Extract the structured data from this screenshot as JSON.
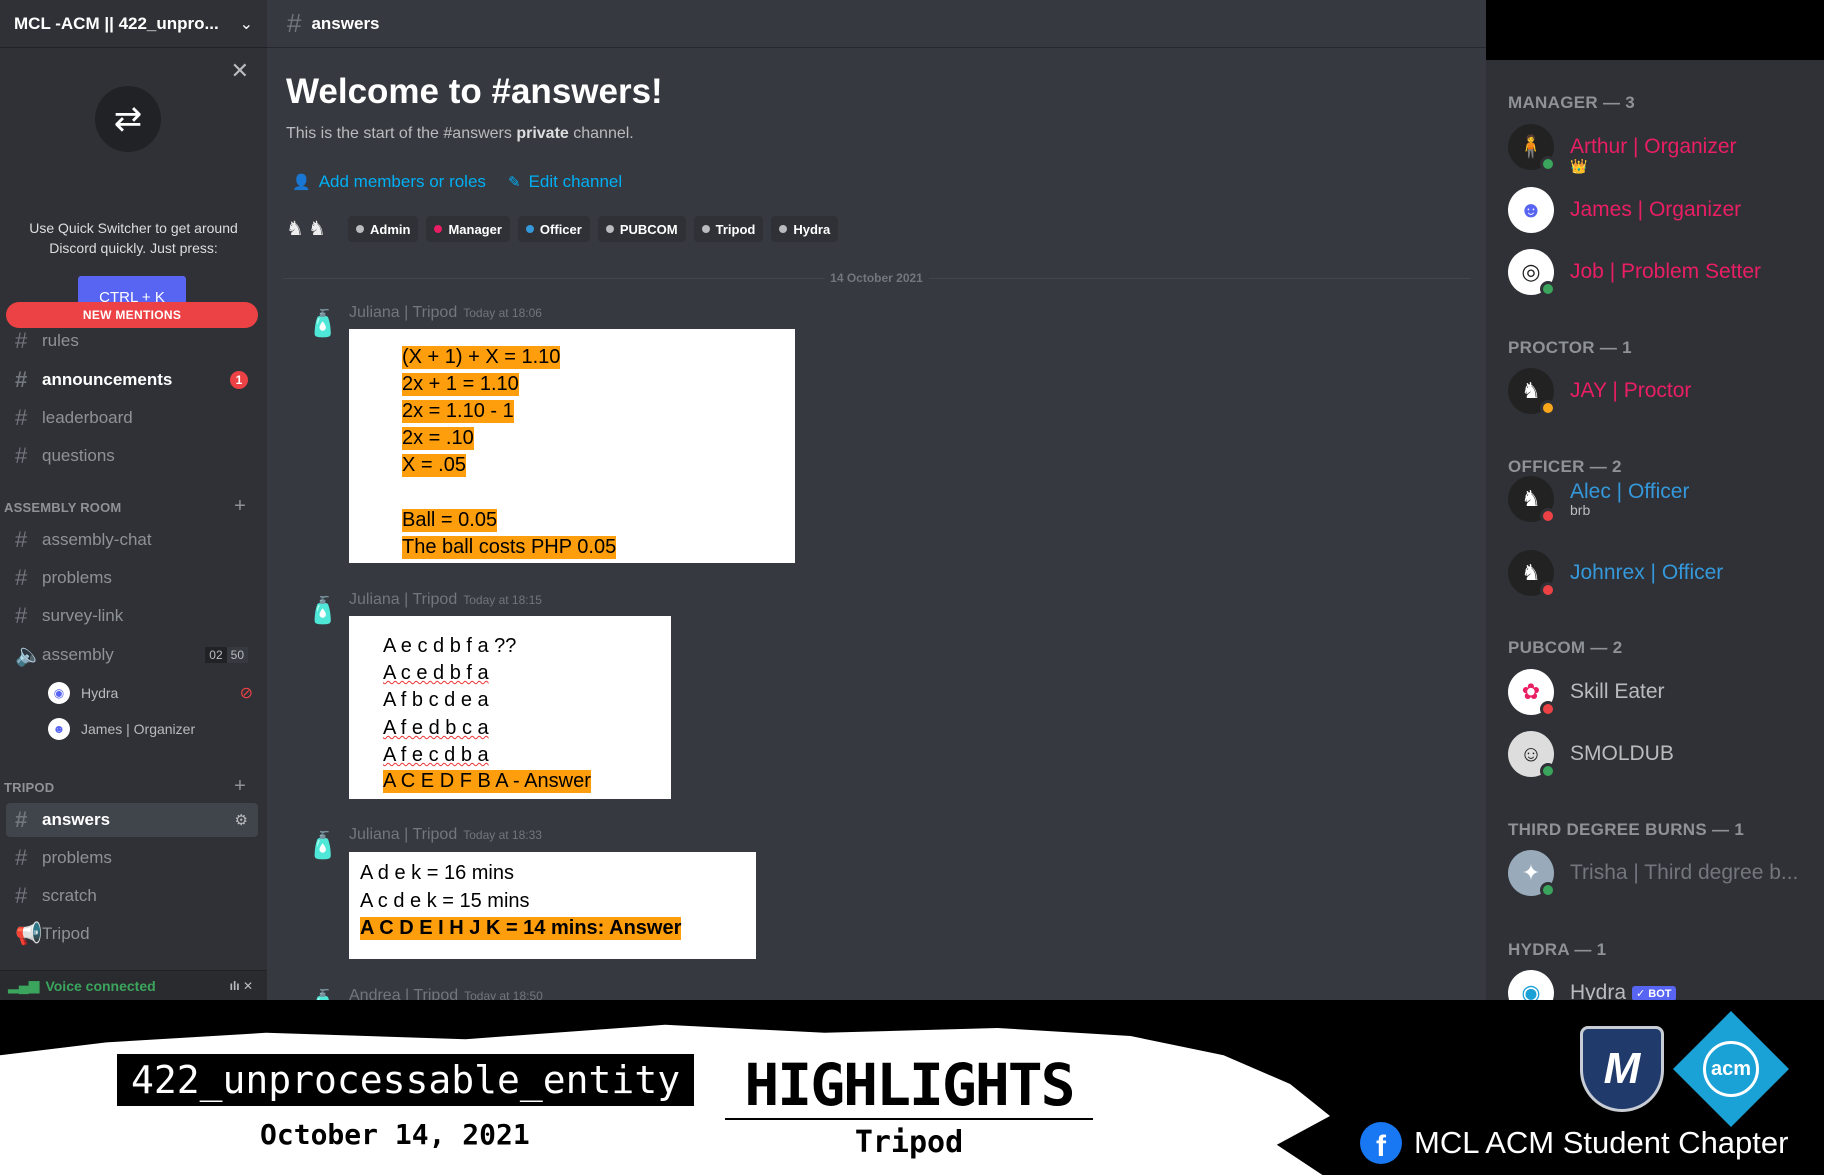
{
  "server": {
    "name": "MCL -ACM || 422_unpro..."
  },
  "quick_switcher": {
    "text_line1": "Use Quick Switcher to get around",
    "text_line2": "Discord quickly. Just press:",
    "shortcut": "CTRL + K"
  },
  "new_mentions": "NEW MENTIONS",
  "channels_top": [
    {
      "name": "rules",
      "bold": false
    },
    {
      "name": "announcements",
      "bold": true,
      "badge": "1"
    },
    {
      "name": "leaderboard",
      "bold": false
    },
    {
      "name": "questions",
      "bold": false
    }
  ],
  "assembly_room": {
    "label": "ASSEMBLY ROOM",
    "channels": [
      "assembly-chat",
      "problems",
      "survey-link"
    ],
    "voice": {
      "name": "assembly",
      "count_a": "02",
      "count_b": "50"
    },
    "voice_users": [
      "Hydra",
      "James | Organizer"
    ]
  },
  "tripod": {
    "label": "TRIPOD",
    "channels": [
      "answers",
      "problems",
      "scratch"
    ],
    "stage": "Tripod"
  },
  "voice_status": "Voice connected",
  "channel": {
    "name": "answers",
    "welcome_title": "Welcome to #answers!",
    "welcome_sub_pre": "This is the start of the #answers ",
    "welcome_sub_bold": "private",
    "welcome_sub_post": " channel.",
    "add_members": "Add members or roles",
    "edit_channel": "Edit channel",
    "roles": [
      {
        "name": "Admin",
        "color": "#b9bbbe"
      },
      {
        "name": "Manager",
        "color": "#e91e63"
      },
      {
        "name": "Officer",
        "color": "#3498db"
      },
      {
        "name": "PUBCOM",
        "color": "#b9bbbe"
      },
      {
        "name": "Tripod",
        "color": "#b9bbbe"
      },
      {
        "name": "Hydra",
        "color": "#b9bbbe"
      }
    ],
    "date_divider": "14 October 2021"
  },
  "messages": [
    {
      "author": "Juliana | Tripod",
      "time": "Today at 18:06",
      "lines": [
        "(X + 1) + X = 1.10",
        "2x + 1 = 1.10",
        "2x = 1.10 - 1",
        "2x = .10",
        "X = .05",
        "",
        "Ball = 0.05",
        "The ball costs PHP 0.05"
      ]
    },
    {
      "author": "Juliana | Tripod",
      "time": "Today at 18:15",
      "lines": [
        "A e c d b f a ??",
        "A c e d b f a",
        "A f b c d e a",
        "A f e d b c a",
        "A f e c d b a",
        "A C E D F B A - Answer"
      ]
    },
    {
      "author": "Juliana | Tripod",
      "time": "Today at 18:33",
      "lines": [
        "A d e k = 16 mins",
        "A c d e k = 15 mins",
        "A C D E I H J K = 14 mins: Answer"
      ]
    },
    {
      "author": "Andrea | Tripod",
      "time": "Today at 18:50"
    }
  ],
  "member_groups": [
    {
      "title": "MANAGER — 3",
      "members": [
        {
          "name": "Arthur | Organizer",
          "color": "#e91e63",
          "status": "#3ba55d",
          "crown": "👑"
        },
        {
          "name": "James | Organizer",
          "color": "#e91e63",
          "status": "",
          "crown": ""
        },
        {
          "name": "Job | Problem Setter",
          "color": "#e91e63",
          "status": "#3ba55d",
          "crown": ""
        }
      ]
    },
    {
      "title": "PROCTOR — 1",
      "members": [
        {
          "name": "JAY | Proctor",
          "color": "#e91e63",
          "status": "#faa61a"
        }
      ]
    },
    {
      "title": "OFFICER — 2",
      "members": [
        {
          "name": "Alec | Officer",
          "color": "#3498db",
          "status": "#ed4245",
          "sub": "brb"
        },
        {
          "name": "Johnrex | Officer",
          "color": "#3498db",
          "status": "#ed4245"
        }
      ]
    },
    {
      "title": "PUBCOM — 2",
      "members": [
        {
          "name": "Skill Eater",
          "color": "#b9bbbe",
          "status": "#ed4245"
        },
        {
          "name": "SMOLDUB",
          "color": "#b9bbbe",
          "status": "#3ba55d"
        }
      ]
    },
    {
      "title": "THIRD DEGREE BURNS — 1",
      "members": [
        {
          "name": "Trisha | Third degree b...",
          "color": "#72767d",
          "status": "#3ba55d"
        }
      ]
    },
    {
      "title": "HYDRA — 1",
      "members": [
        {
          "name": "Hydra",
          "color": "#b9bbbe",
          "status": "",
          "bot": "✓ BOT"
        }
      ]
    }
  ],
  "banner": {
    "team": "422_unprocessable_entity",
    "date": "October 14, 2021",
    "title": "HIGHLIGHTS",
    "event": "Tripod",
    "org": "MCL ACM Student Chapter",
    "logo_text": "acm",
    "fb": "f"
  }
}
